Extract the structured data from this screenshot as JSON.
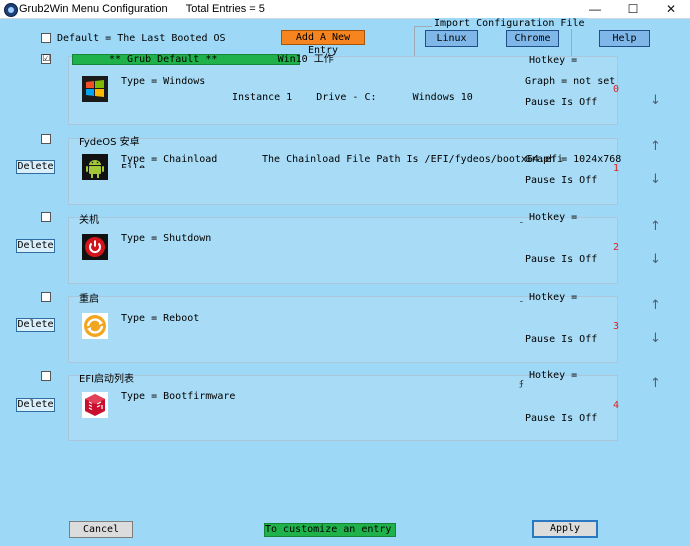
{
  "window": {
    "title": "Grub2Win Menu Configuration",
    "total_entries": "Total Entries = 5",
    "minimize": "—",
    "maximize": "☐",
    "close": "✕"
  },
  "header": {
    "default_label": "Default = The Last Booted OS",
    "add_entry_label": "Add A New Entry",
    "import_title": "Import Configuration File",
    "linux_label": "Linux",
    "chrome_label": "Chrome",
    "help_label": "Help"
  },
  "entries": [
    {
      "checked": "☑",
      "green_label": "** Grub Default **          Win10 工作",
      "type": "Type = Windows",
      "detail": "Instance 1    Drive - C:      Windows 10",
      "hotkey": "Hotkey =",
      "graph": "Graph = not set",
      "pause": "Pause Is Off",
      "number": "0",
      "icon": "windows-logo-icon"
    },
    {
      "name": "FydeOS 安卓",
      "type": "Type = Chainload",
      "extra": "File",
      "detail": "The Chainload File Path Is /EFI/fydeos/bootx64.efi",
      "graph": "Graph = 1024x768",
      "pause": "Pause Is Off",
      "number": "1",
      "delete": "Delete",
      "icon": "android-icon"
    },
    {
      "name": "关机",
      "type": "Type = Shutdown",
      "hotkey": "Hotkey =",
      "pause": "Pause Is Off",
      "number": "2",
      "delete": "Delete",
      "icon": "power-icon"
    },
    {
      "name": "重启",
      "type": "Type = Reboot",
      "hotkey": "Hotkey =",
      "pause": "Pause Is Off",
      "number": "3",
      "delete": "Delete",
      "icon": "reboot-icon"
    },
    {
      "name": "EFI启动列表",
      "type": "Type = Bootfirmware",
      "hotkey": "Hotkey =",
      "pause": "Pause Is Off",
      "number": "4",
      "delete": "Delete",
      "icon": "efi-icon"
    }
  ],
  "footer": {
    "cancel_label": "Cancel",
    "customize_text": "To customize an entry -",
    "apply_label": "Apply"
  },
  "colors": {
    "client_bg": "#9dd8f7",
    "panel_bg": "#a8dcf6",
    "green": "#1fb24a",
    "orange": "#f6841f",
    "number_red": "#e02020"
  }
}
